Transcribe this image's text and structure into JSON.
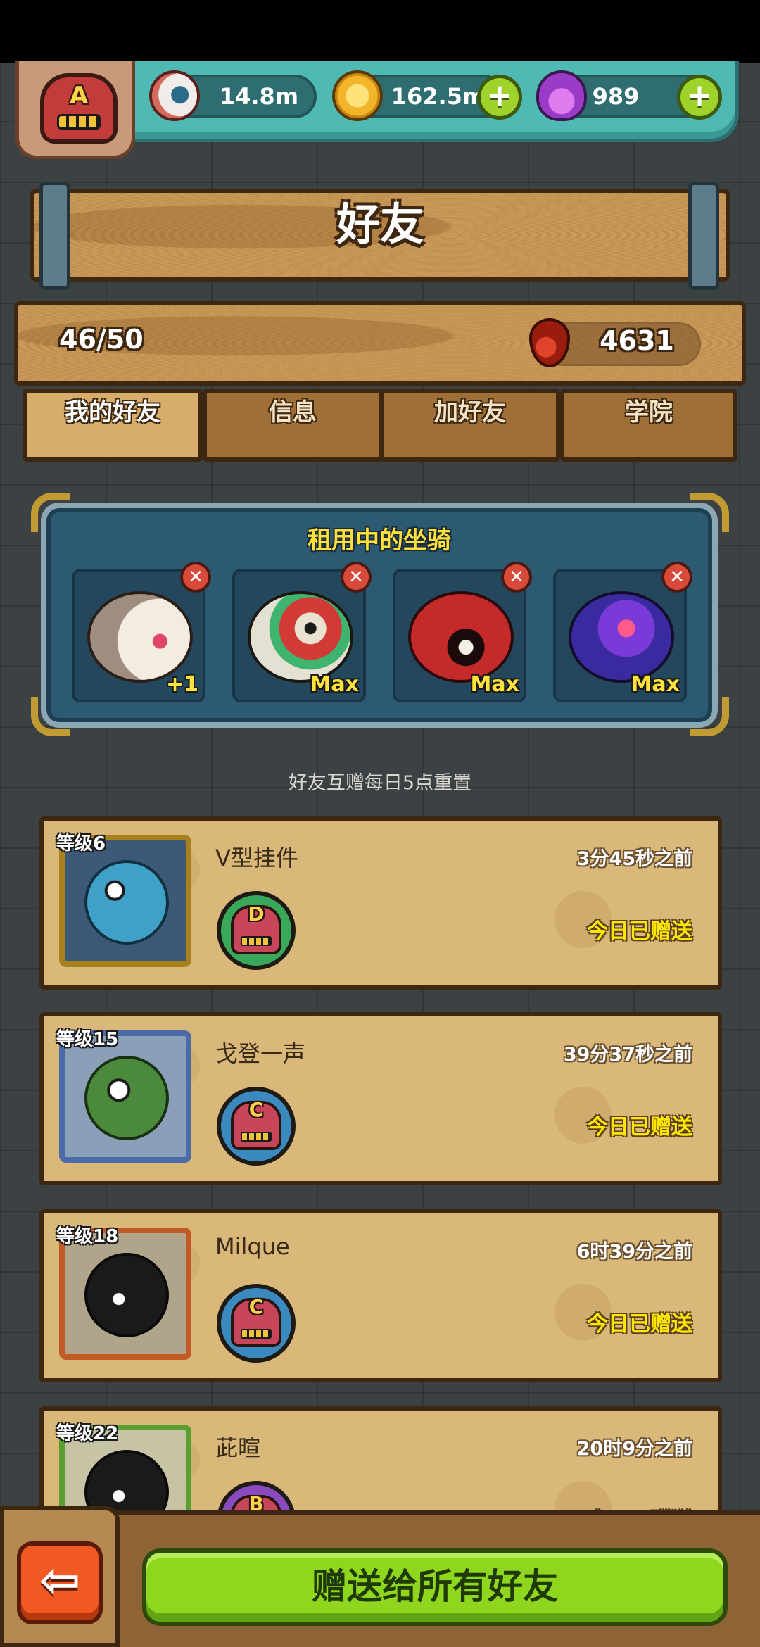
{
  "player": {
    "rank": "A"
  },
  "resources": {
    "eyes": "14.8m",
    "coins": "162.5m",
    "potions": "989",
    "plus_symbol": "+"
  },
  "page_title": "好友",
  "friends_count": "46/50",
  "blood_points": "4631",
  "tabs": [
    {
      "label": "我的好友",
      "active": true
    },
    {
      "label": "信息",
      "active": false
    },
    {
      "label": "加好友",
      "active": false
    },
    {
      "label": "学院",
      "active": false
    }
  ],
  "rented_mounts": {
    "title": "租用中的坐骑",
    "remove_symbol": "✕",
    "slots": [
      {
        "level": "+1"
      },
      {
        "level": "Max"
      },
      {
        "level": "Max"
      },
      {
        "level": "Max"
      }
    ]
  },
  "reset_note": "好友互赠每日5点重置",
  "friends": [
    {
      "level": "等级6",
      "name": "V型挂件",
      "last_seen": "3分45秒之前",
      "rank": "D",
      "status": "今日已赠送"
    },
    {
      "level": "等级15",
      "name": "戈登一声",
      "last_seen": "39分37秒之前",
      "rank": "C",
      "status": "今日已赠送"
    },
    {
      "level": "等级18",
      "name": "Milque",
      "last_seen": "6时39分之前",
      "rank": "C",
      "status": "今日已赠送"
    },
    {
      "level": "等级22",
      "name": "茈暄",
      "last_seen": "20时9分之前",
      "rank": "B",
      "status": "今日已赠送"
    }
  ],
  "bottom": {
    "back_symbol": "⇦",
    "send_all_label": "赠送给所有好友"
  }
}
